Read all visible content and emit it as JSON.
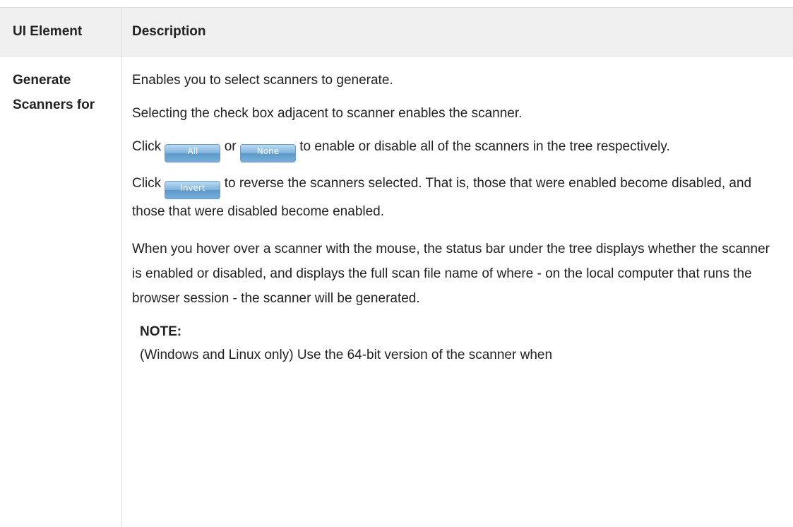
{
  "table": {
    "headers": {
      "ui_element": "UI Element",
      "description": "Description"
    },
    "row": {
      "element": "Generate Scanners for",
      "desc": {
        "p1": "Enables you to select scanners to generate.",
        "p2": "Selecting the check box adjacent to scanner enables the scanner.",
        "p3_pre": "Click",
        "btn_all": "All",
        "p3_mid": "or",
        "btn_none": "None",
        "p3_post": "to enable or disable all of the scanners in the tree respectively.",
        "p4_pre": "Click",
        "btn_invert": "Invert",
        "p4_post": "to reverse the scanners selected. That is, those that were enabled become disabled, and those that were disabled become enabled.",
        "p5": "When you hover over a scanner with the mouse, the status bar under the tree displays whether the scanner is enabled or disabled, and displays the full scan file name of where - on the local computer that runs the browser session - the scanner will be generated.",
        "note_label": "NOTE:",
        "note_text": "(Windows and Linux only) Use the 64-bit version of the scanner when"
      }
    }
  },
  "colors": {
    "header_bg": "#f0f0f0",
    "border": "#dcdcdc",
    "button": "#7fb4de",
    "text": "#222222"
  }
}
